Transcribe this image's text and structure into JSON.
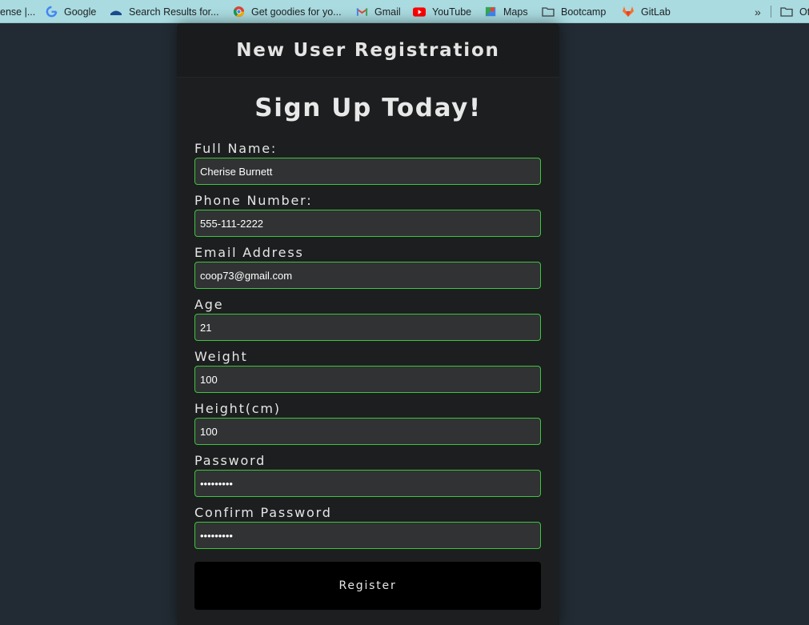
{
  "bookmarks": {
    "items": [
      {
        "label": "ense |...",
        "icon": "truncated-site-icon"
      },
      {
        "label": "Google",
        "icon": "google-icon"
      },
      {
        "label": "Search Results for...",
        "icon": "site-icon"
      },
      {
        "label": "Get goodies for yo...",
        "icon": "chrome-icon"
      },
      {
        "label": "Gmail",
        "icon": "gmail-icon"
      },
      {
        "label": "YouTube",
        "icon": "youtube-icon"
      },
      {
        "label": "Maps",
        "icon": "maps-icon"
      },
      {
        "label": "Bootcamp",
        "icon": "folder-icon"
      },
      {
        "label": "GitLab",
        "icon": "gitlab-icon"
      }
    ],
    "overflow": "»",
    "other_label": "Ot"
  },
  "form": {
    "header_title": "New User Registration",
    "heading": "Sign Up Today!",
    "fields": [
      {
        "label": "Full Name:",
        "value": "Cherise Burnett",
        "type": "text"
      },
      {
        "label": "Phone Number:",
        "value": "555-111-2222",
        "type": "text"
      },
      {
        "label": "Email Address",
        "value": "coop73@gmail.com",
        "type": "text"
      },
      {
        "label": "Age",
        "value": "21",
        "type": "text"
      },
      {
        "label": "Weight",
        "value": "100",
        "type": "text"
      },
      {
        "label": "Height(cm)",
        "value": "100",
        "type": "text"
      },
      {
        "label": "Password",
        "value": "123456789",
        "type": "password"
      },
      {
        "label": "Confirm Password",
        "value": "123456789",
        "type": "password"
      }
    ],
    "register_label": "Register"
  },
  "colors": {
    "page_background": "#222b33",
    "card_background": "#1c1e1f",
    "input_border": "#3fc43f",
    "bookmarks_bar": "#a9dbe0"
  }
}
